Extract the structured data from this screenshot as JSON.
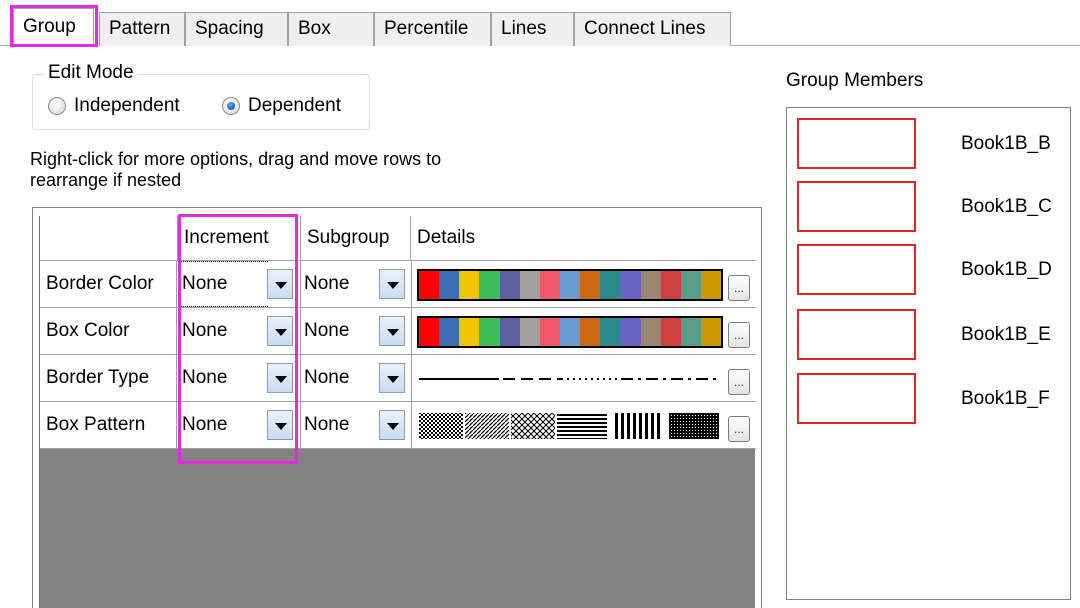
{
  "tabs": [
    {
      "label": "Group",
      "active": true
    },
    {
      "label": "Pattern",
      "active": false
    },
    {
      "label": "Spacing",
      "active": false
    },
    {
      "label": "Box",
      "active": false
    },
    {
      "label": "Percentile",
      "active": false
    },
    {
      "label": "Lines",
      "active": false
    },
    {
      "label": "Connect Lines",
      "active": false
    }
  ],
  "edit_mode": {
    "title": "Edit Mode",
    "options": [
      {
        "label": "Independent",
        "selected": false
      },
      {
        "label": "Dependent",
        "selected": true
      }
    ]
  },
  "hint": "Right-click for more options, drag and move rows to  rearrange if nested",
  "grid": {
    "columns": [
      "",
      "Increment",
      "Subgroup",
      "Details"
    ],
    "rows": [
      {
        "label": "Border Color",
        "increment": "None",
        "subgroup": "None",
        "details": "color-swatches"
      },
      {
        "label": "Box Color",
        "increment": "None",
        "subgroup": "None",
        "details": "color-swatches"
      },
      {
        "label": "Border Type",
        "increment": "None",
        "subgroup": "None",
        "details": "line-styles"
      },
      {
        "label": "Box Pattern",
        "increment": "None",
        "subgroup": "None",
        "details": "fill-patterns"
      }
    ],
    "ellipsis_label": "..."
  },
  "color_swatches": [
    "#ff0000",
    "#3a6db4",
    "#f5c400",
    "#3dbd5a",
    "#5d5f9e",
    "#a0a0a0",
    "#ef5a68",
    "#6a9bd2",
    "#cc6a12",
    "#2c8a8c",
    "#6966c2",
    "#9e8570",
    "#d03f41",
    "#5b9c8b",
    "#cc9a00"
  ],
  "group_members": {
    "title": "Group Members",
    "members": [
      "Book1B_B",
      "Book1B_C",
      "Book1B_D",
      "Book1B_E",
      "Book1B_F"
    ],
    "outline_color": "#e02525"
  },
  "highlight_color": "#e22be0"
}
